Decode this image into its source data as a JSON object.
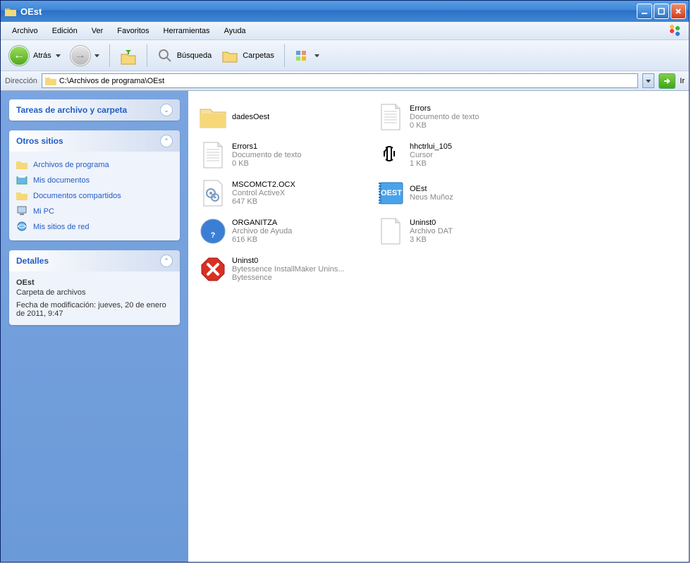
{
  "titlebar": {
    "title": "OEst"
  },
  "menubar": {
    "archivo": "Archivo",
    "edicion": "Edición",
    "ver": "Ver",
    "favoritos": "Favoritos",
    "herramientas": "Herramientas",
    "ayuda": "Ayuda"
  },
  "toolbar": {
    "atras": "Atrás",
    "busqueda": "Búsqueda",
    "carpetas": "Carpetas"
  },
  "addrbar": {
    "label": "Dirección",
    "path": "C:\\Archivos de programa\\OEst",
    "go": "Ir"
  },
  "sidebar": {
    "tasks_title": "Tareas de archivo y carpeta",
    "places_title": "Otros sitios",
    "places": {
      "archivos": "Archivos de programa",
      "misdocs": "Mis documentos",
      "compartidos": "Documentos compartidos",
      "mipc": "Mi PC",
      "red": "Mis sitios de red"
    },
    "details_title": "Detalles",
    "details": {
      "name": "OEst",
      "type": "Carpeta de archivos",
      "modified": "Fecha de modificación: jueves, 20 de enero de 2011, 9:47"
    }
  },
  "files": {
    "f0": {
      "name": "dadesOest",
      "meta1": "",
      "meta2": ""
    },
    "f1": {
      "name": "Errors",
      "meta1": "Documento de texto",
      "meta2": "0 KB"
    },
    "f2": {
      "name": "Errors1",
      "meta1": "Documento de texto",
      "meta2": "0 KB"
    },
    "f3": {
      "name": "hhctrlui_105",
      "meta1": "Cursor",
      "meta2": "1 KB"
    },
    "f4": {
      "name": "MSCOMCT2.OCX",
      "meta1": "Control ActiveX",
      "meta2": "647 KB"
    },
    "f5": {
      "name": "OEst",
      "meta1": "Neus Muñoz",
      "meta2": ""
    },
    "f6": {
      "name": "ORGANITZA",
      "meta1": "Archivo de Ayuda",
      "meta2": "616 KB"
    },
    "f7": {
      "name": "Uninst0",
      "meta1": "Archivo DAT",
      "meta2": "3 KB"
    },
    "f8": {
      "name": "Uninst0",
      "meta1": "Bytessence InstallMaker Unins...",
      "meta2": "Bytessence"
    }
  }
}
